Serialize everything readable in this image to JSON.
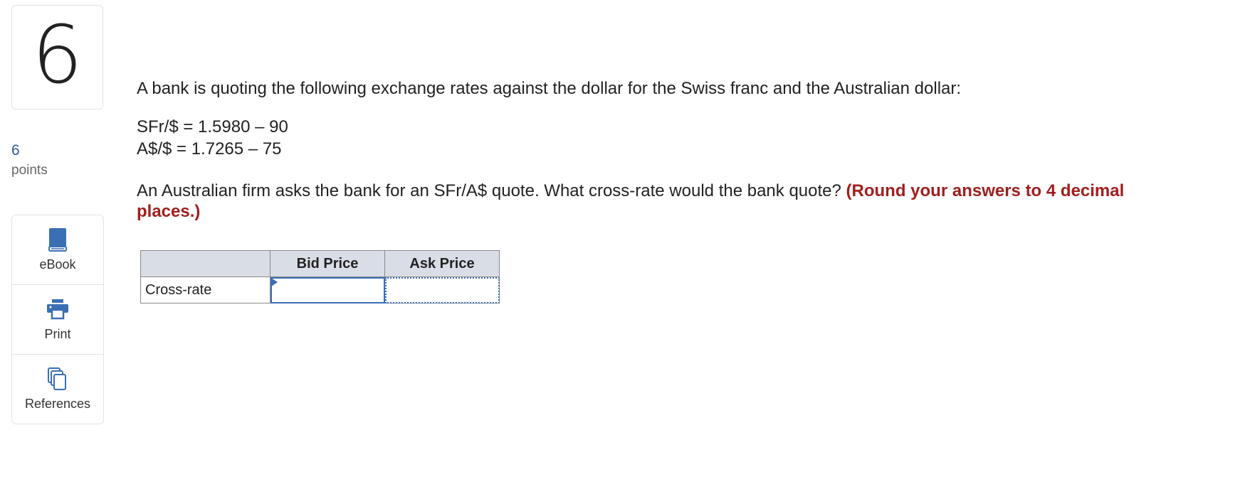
{
  "question": {
    "number": "6",
    "points_value": "6",
    "points_label": "points",
    "prompt": "A bank is quoting the following exchange rates against the dollar for the Swiss franc and the Australian dollar:",
    "quotes": [
      "SFr/$ = 1.5980 – 90",
      "A$/$ = 1.7265 – 75"
    ],
    "question_text": "An Australian firm asks the bank for an SFr/A$ quote. What cross-rate would the bank quote?",
    "instruction": "(Round your answers to 4 decimal places.)"
  },
  "tools": [
    {
      "label": "eBook",
      "icon": "book-icon"
    },
    {
      "label": "Print",
      "icon": "printer-icon"
    },
    {
      "label": "References",
      "icon": "documents-icon"
    }
  ],
  "answer_table": {
    "headers": [
      "",
      "Bid Price",
      "Ask Price"
    ],
    "row_label": "Cross-rate",
    "bid_value": "",
    "ask_value": ""
  },
  "colors": {
    "accent": "#3b6fb4",
    "instruction": "#a11e1e",
    "header_bg": "#d9dde6",
    "points": "#2d5a9a"
  }
}
